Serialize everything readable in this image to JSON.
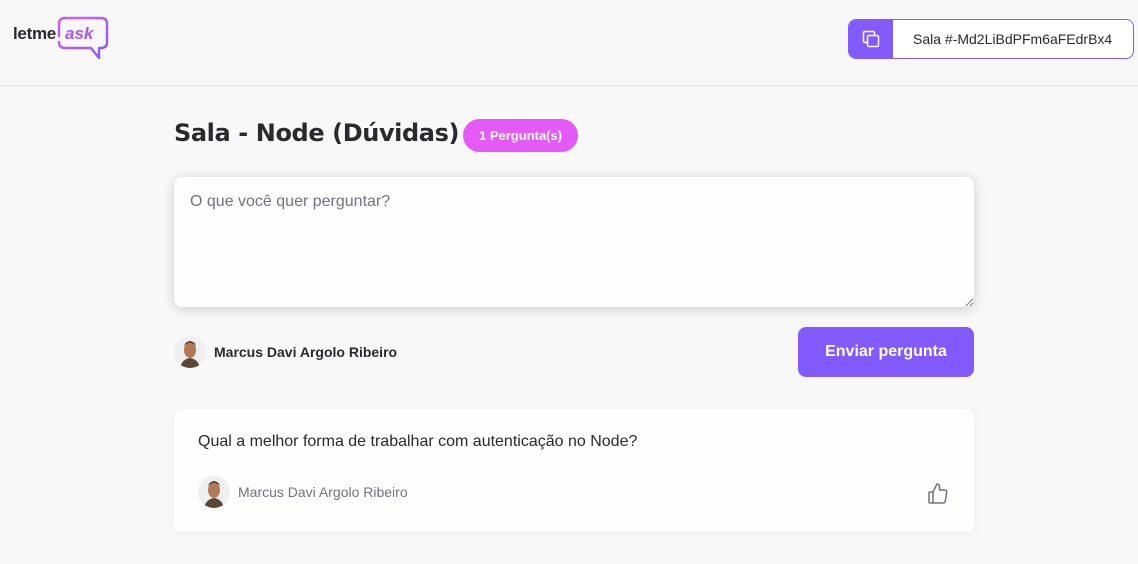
{
  "header": {
    "logo": {
      "part1": "letme",
      "part2": "ask"
    },
    "room_code": {
      "label": "Sala #-Md2LiBdPFm6aFEdrBx4",
      "icon": "copy-icon"
    }
  },
  "room": {
    "title": "Sala - Node (Dúvidas)",
    "question_count": "1 Pergunta(s)"
  },
  "form": {
    "placeholder": "O que você quer perguntar?",
    "value": "",
    "user_name": "Marcus Davi Argolo Ribeiro",
    "submit_label": "Enviar pergunta"
  },
  "questions": [
    {
      "content": "Qual a melhor forma de trabalhar com autenticação no Node?",
      "author": "Marcus Davi Argolo Ribeiro",
      "like_icon": "thumbs-up-icon"
    }
  ],
  "colors": {
    "primary": "#835afd",
    "badge": "#e559f9",
    "background": "#f8f8f8",
    "text": "#29292e",
    "muted": "#737380"
  }
}
